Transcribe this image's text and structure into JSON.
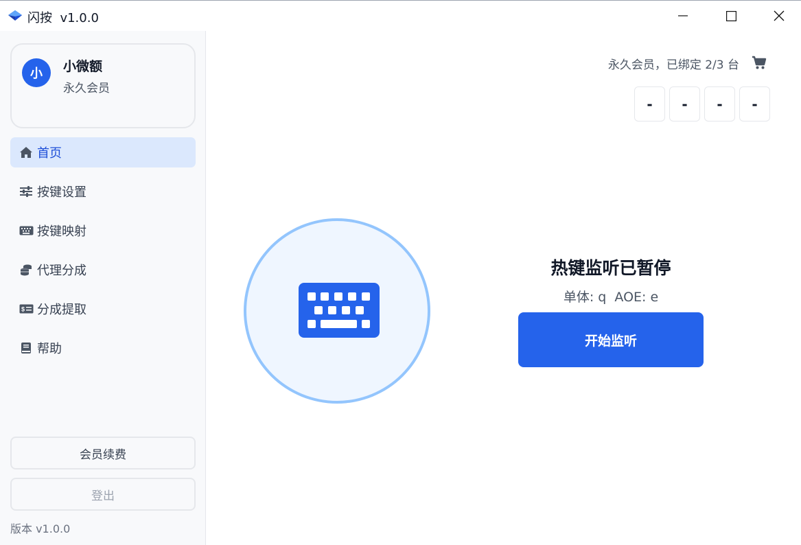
{
  "window": {
    "title": "闪按  v1.0.0",
    "app_icon": "blue-diamond-app-icon",
    "controls": [
      "minimize-icon",
      "maximize-icon",
      "close-icon"
    ]
  },
  "user": {
    "avatar_text": "小",
    "name": "小微额",
    "role": "永久会员"
  },
  "nav": {
    "items": [
      {
        "label": "首页",
        "icon": "home-icon",
        "active": true
      },
      {
        "label": "按键设置",
        "icon": "sliders-icon",
        "active": false
      },
      {
        "label": "按键映射",
        "icon": "keyboard-icon",
        "active": false
      },
      {
        "label": "代理分成",
        "icon": "coins-icon",
        "active": false
      },
      {
        "label": "分成提取",
        "icon": "money-bill-icon",
        "active": false
      },
      {
        "label": "帮助",
        "icon": "book-icon",
        "active": false
      }
    ]
  },
  "sidebar_buttons": {
    "renew": "会员续费",
    "logout": "登出"
  },
  "version_label": "版本 v1.0.0",
  "membership": {
    "status_text": "永久会员，已绑定 2/3 台",
    "cart_icon": "cart-icon"
  },
  "code_boxes": [
    "-",
    "-",
    "-",
    "-"
  ],
  "hotkey": {
    "status": "热键监听已暂停",
    "keys_text": "单体: q  AOE: e",
    "start_button": "开始监听"
  },
  "colors": {
    "accent": "#2563eb",
    "active_nav_bg": "#dbe8fd",
    "circle_border": "#93c5fd",
    "circle_bg": "#eff6ff"
  }
}
